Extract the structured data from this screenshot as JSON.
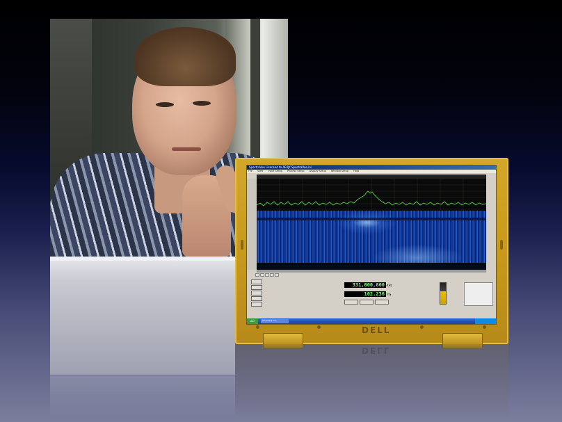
{
  "app": {
    "title": "SpectraVue Licensed to AE4JY   SpectraVue.ini",
    "menu": [
      "File",
      "View",
      "Input Setup",
      "Process Setup",
      "Display Setup",
      "Window Setup",
      "Help"
    ]
  },
  "display": {
    "center_frequency": "331,000,000",
    "frequency_unit": "KHz",
    "sweep_time": "102.236",
    "time_unit": "mS"
  },
  "taskbar": {
    "start_label": "start",
    "task_label": "SpectraVue Lim..."
  },
  "device": {
    "brand": "DELL",
    "reflection_brand": "DELL"
  },
  "colors": {
    "background_top": "#000000",
    "background_bottom": "#7b7e9c",
    "laptop_bezel": "#c79a1d",
    "spectrum_trace": "#55d13a",
    "waterfall": "#1a4fc4",
    "lcd_text": "#7cff7c"
  },
  "icons": {
    "start": "windows-start-icon",
    "logo": "dell-logo"
  }
}
